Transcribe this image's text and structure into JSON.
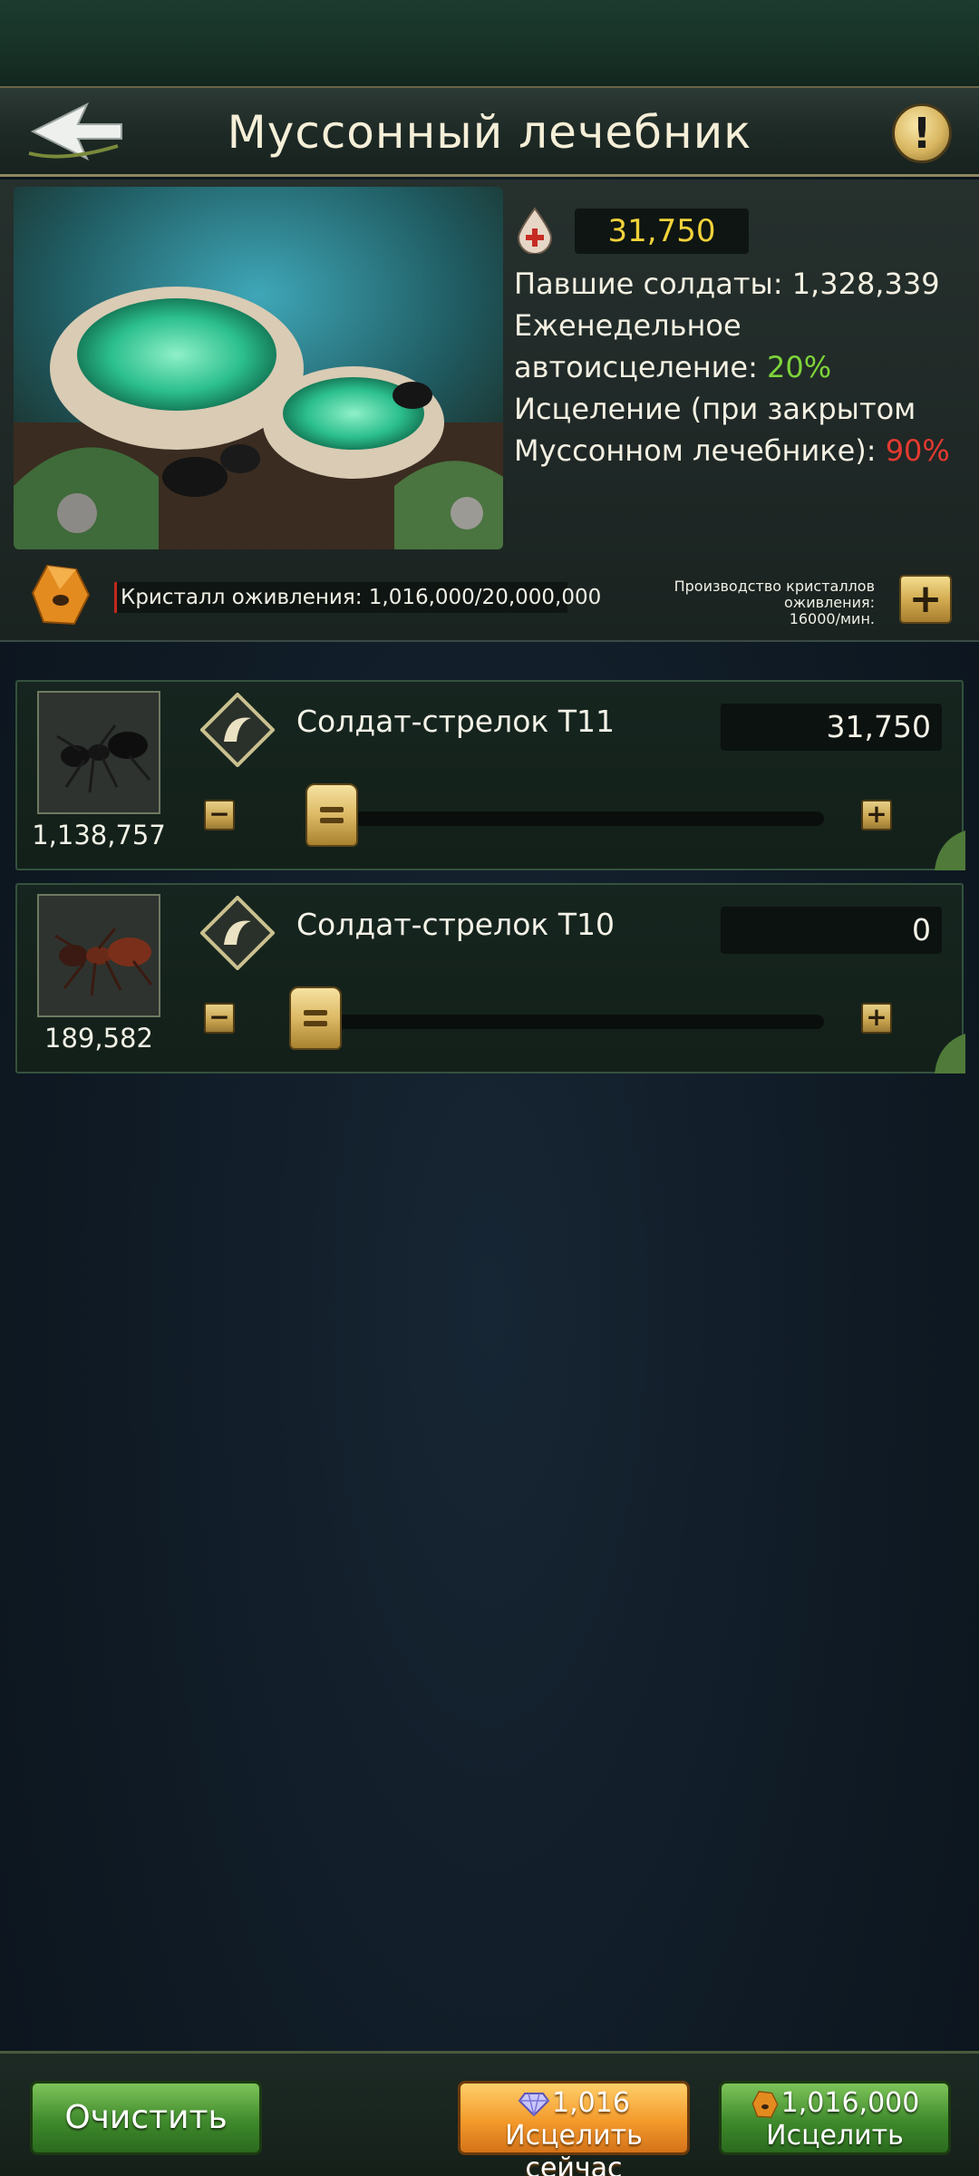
{
  "header": {
    "title": "Муссонный лечебник",
    "back_icon": "back-arrow-icon",
    "info_icon": "exclamation-icon",
    "info_symbol": "!"
  },
  "info_panel": {
    "heal_count": "31,750",
    "fallen_label": "Павшие солдаты:",
    "fallen_value": "1,328,339",
    "weekly_label_1": "Еженедельное",
    "weekly_label_2": "автоисцеление:",
    "weekly_value": "20%",
    "closed_label_1": "Исцеление (при закрытом",
    "closed_label_2": "Муссонном лечебнике):",
    "closed_value": "90%",
    "crystal_text": "Кристалл оживления: 1,016,000/20,000,000",
    "production_line1": "Производство кристаллов оживления:",
    "production_line2": "16000/мин.",
    "plus_symbol": "+"
  },
  "units": [
    {
      "count": "1,138,757",
      "name": "Солдат-стрелок T11",
      "value": "31,750",
      "slider_fraction": 0.03,
      "minus": "−",
      "plus": "+"
    },
    {
      "count": "189,582",
      "name": "Солдат-стрелок T10",
      "value": "0",
      "slider_fraction": 0,
      "minus": "−",
      "plus": "+"
    }
  ],
  "bottom": {
    "clear_label": "Очистить",
    "heal_now_cost": "1,016",
    "heal_now_label": "Исцелить сейчас",
    "heal_cost": "1,016,000",
    "heal_label": "Исцелить"
  },
  "colors": {
    "accent_gold": "#d8b660",
    "green_value": "#7ed43a",
    "red_value": "#e33a30",
    "count_yellow": "#f2d23a"
  }
}
